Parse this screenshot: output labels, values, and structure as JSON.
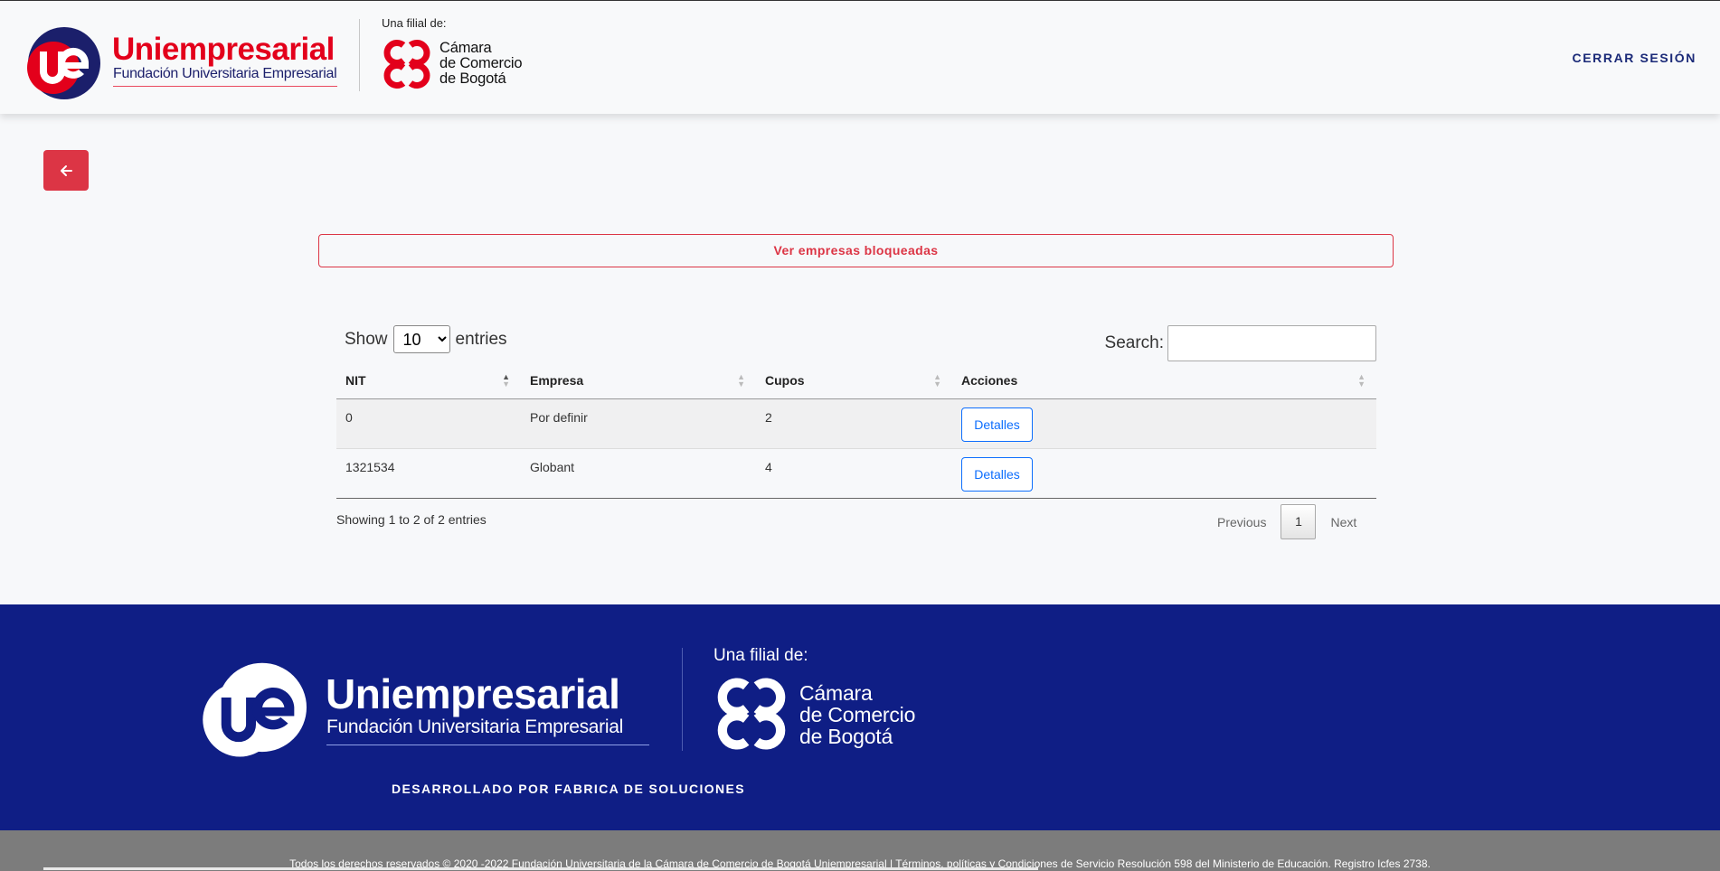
{
  "header": {
    "brand_title": "Uniempresarial",
    "brand_subtitle": "Fundación Universitaria Empresarial",
    "filial_label": "Una filial de:",
    "partner_lines": [
      "Cámara",
      "de Comercio",
      "de Bogotá"
    ],
    "logout_label": "CERRAR SESIÓN"
  },
  "colors": {
    "brand_red": "#e3001b",
    "navy": "#0f1e85",
    "danger": "#dc3545",
    "primary": "#0d6efd"
  },
  "main": {
    "back_icon": "arrow-left-icon",
    "blocked_label": "Ver empresas bloqueadas",
    "table": {
      "show_label": "Show",
      "entries_label": "entries",
      "page_length": "10",
      "search_label": "Search:",
      "search_value": "",
      "columns": [
        "NIT",
        "Empresa",
        "Cupos",
        "Acciones"
      ],
      "rows": [
        {
          "nit": "0",
          "empresa": "Por definir",
          "cupos": "2",
          "action": "Detalles"
        },
        {
          "nit": "1321534",
          "empresa": "Globant",
          "cupos": "4",
          "action": "Detalles"
        }
      ],
      "info": "Showing 1 to 2 of 2 entries",
      "pagination": {
        "previous": "Previous",
        "current": "1",
        "next": "Next"
      }
    }
  },
  "footer": {
    "brand_title": "Uniempresarial",
    "brand_subtitle": "Fundación Universitaria Empresarial",
    "filial_label": "Una filial de:",
    "partner_lines": [
      "Cámara",
      "de Comercio",
      "de Bogotá"
    ],
    "developed_by": "DESARROLLADO POR FABRICA DE SOLUCIONES",
    "copyright": "Todos los derechos reservados © 2020 -2022 Fundación Universitaria de la Cámara de Comercio de Bogotá Uniempresarial | Términos, políticas y Condiciones de Servicio Resolución 598 del Ministerio de Educación. Registro Icfes 2738."
  }
}
